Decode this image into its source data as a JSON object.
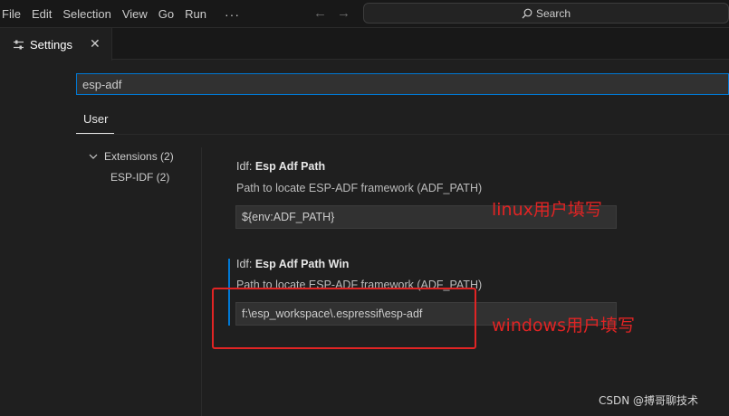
{
  "menu": {
    "items": [
      "File",
      "Edit",
      "Selection",
      "View",
      "Go",
      "Run"
    ],
    "more": "···"
  },
  "nav": {
    "back": "←",
    "forward": "→"
  },
  "search": {
    "label": "Search"
  },
  "tabs": [
    {
      "label": "Settings",
      "close": "✕"
    }
  ],
  "settings_search": {
    "value": "esp-adf"
  },
  "scope": {
    "active": "User"
  },
  "toc": {
    "extensions": "Extensions (2)",
    "esp_idf": "ESP-IDF (2)"
  },
  "settings": [
    {
      "category": "Idf: ",
      "name": "Esp Adf Path",
      "description": "Path to locate ESP-ADF framework (ADF_PATH)",
      "value": "${env:ADF_PATH}"
    },
    {
      "category": "Idf: ",
      "name": "Esp Adf Path Win",
      "description": "Path to locate ESP-ADF framework (ADF_PATH)",
      "value": "f:\\esp_workspace\\.espressif\\esp-adf"
    }
  ],
  "annotations": {
    "linux": "linux用户填写",
    "windows": "windows用户填写",
    "color": "#e02424"
  },
  "watermark": "CSDN @搏哥聊技术",
  "colors": {
    "accent": "#0078d4",
    "background": "#1f1f1f"
  }
}
